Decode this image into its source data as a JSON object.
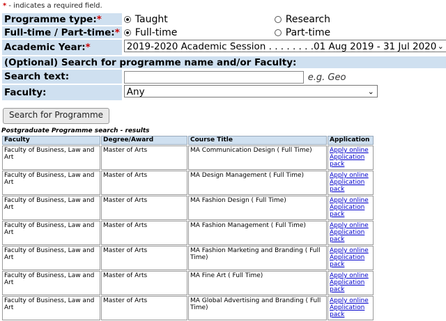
{
  "required_note": "- indicates a required field.",
  "form": {
    "programme_type": {
      "label": "Programme type:",
      "options": [
        {
          "label": "Taught",
          "selected": true
        },
        {
          "label": "Research",
          "selected": false
        }
      ]
    },
    "study_mode": {
      "label": "Full-time / Part-time:",
      "options": [
        {
          "label": "Full-time",
          "selected": true
        },
        {
          "label": "Part-time",
          "selected": false
        }
      ]
    },
    "academic_year": {
      "label": "Academic Year:",
      "value": "2019-2020 Academic Session . . . . . . . .01 Aug 2019 - 31 Jul 2020"
    },
    "optional_heading": "(Optional) Search for programme name and/or Faculty:",
    "search_text": {
      "label": "Search text:",
      "value": "",
      "hint": "e.g. Geo"
    },
    "faculty": {
      "label": "Faculty:",
      "value": "Any"
    }
  },
  "search_button": "Search for Programme",
  "results": {
    "caption": "Postgraduate Programme search - results",
    "headers": [
      "Faculty",
      "Degree/Award",
      "Course Title",
      "Application"
    ],
    "rows": [
      {
        "faculty": "Faculty of Business, Law and Art",
        "degree": "Master of Arts",
        "title": "MA Communication Design ( Full Time)",
        "apply": "Apply online",
        "pack": "Application pack"
      },
      {
        "faculty": "Faculty of Business, Law and Art",
        "degree": "Master of Arts",
        "title": "MA Design Management ( Full Time)",
        "apply": "Apply online",
        "pack": "Application pack"
      },
      {
        "faculty": "Faculty of Business, Law and Art",
        "degree": "Master of Arts",
        "title": "MA Fashion Design ( Full Time)",
        "apply": "Apply online",
        "pack": "Application pack"
      },
      {
        "faculty": "Faculty of Business, Law and Art",
        "degree": "Master of Arts",
        "title": "MA Fashion Management ( Full Time)",
        "apply": "Apply online",
        "pack": "Application pack"
      },
      {
        "faculty": "Faculty of Business, Law and Art",
        "degree": "Master of Arts",
        "title": "MA Fashion Marketing and Branding ( Full Time)",
        "apply": "Apply online",
        "pack": "Application pack"
      },
      {
        "faculty": "Faculty of Business, Law and Art",
        "degree": "Master of Arts",
        "title": "MA Fine Art ( Full Time)",
        "apply": "Apply online",
        "pack": "Application pack"
      },
      {
        "faculty": "Faculty of Business, Law and Art",
        "degree": "Master of Arts",
        "title": "MA Global Advertising and Branding ( Full Time)",
        "apply": "Apply online",
        "pack": "Application pack"
      }
    ]
  }
}
